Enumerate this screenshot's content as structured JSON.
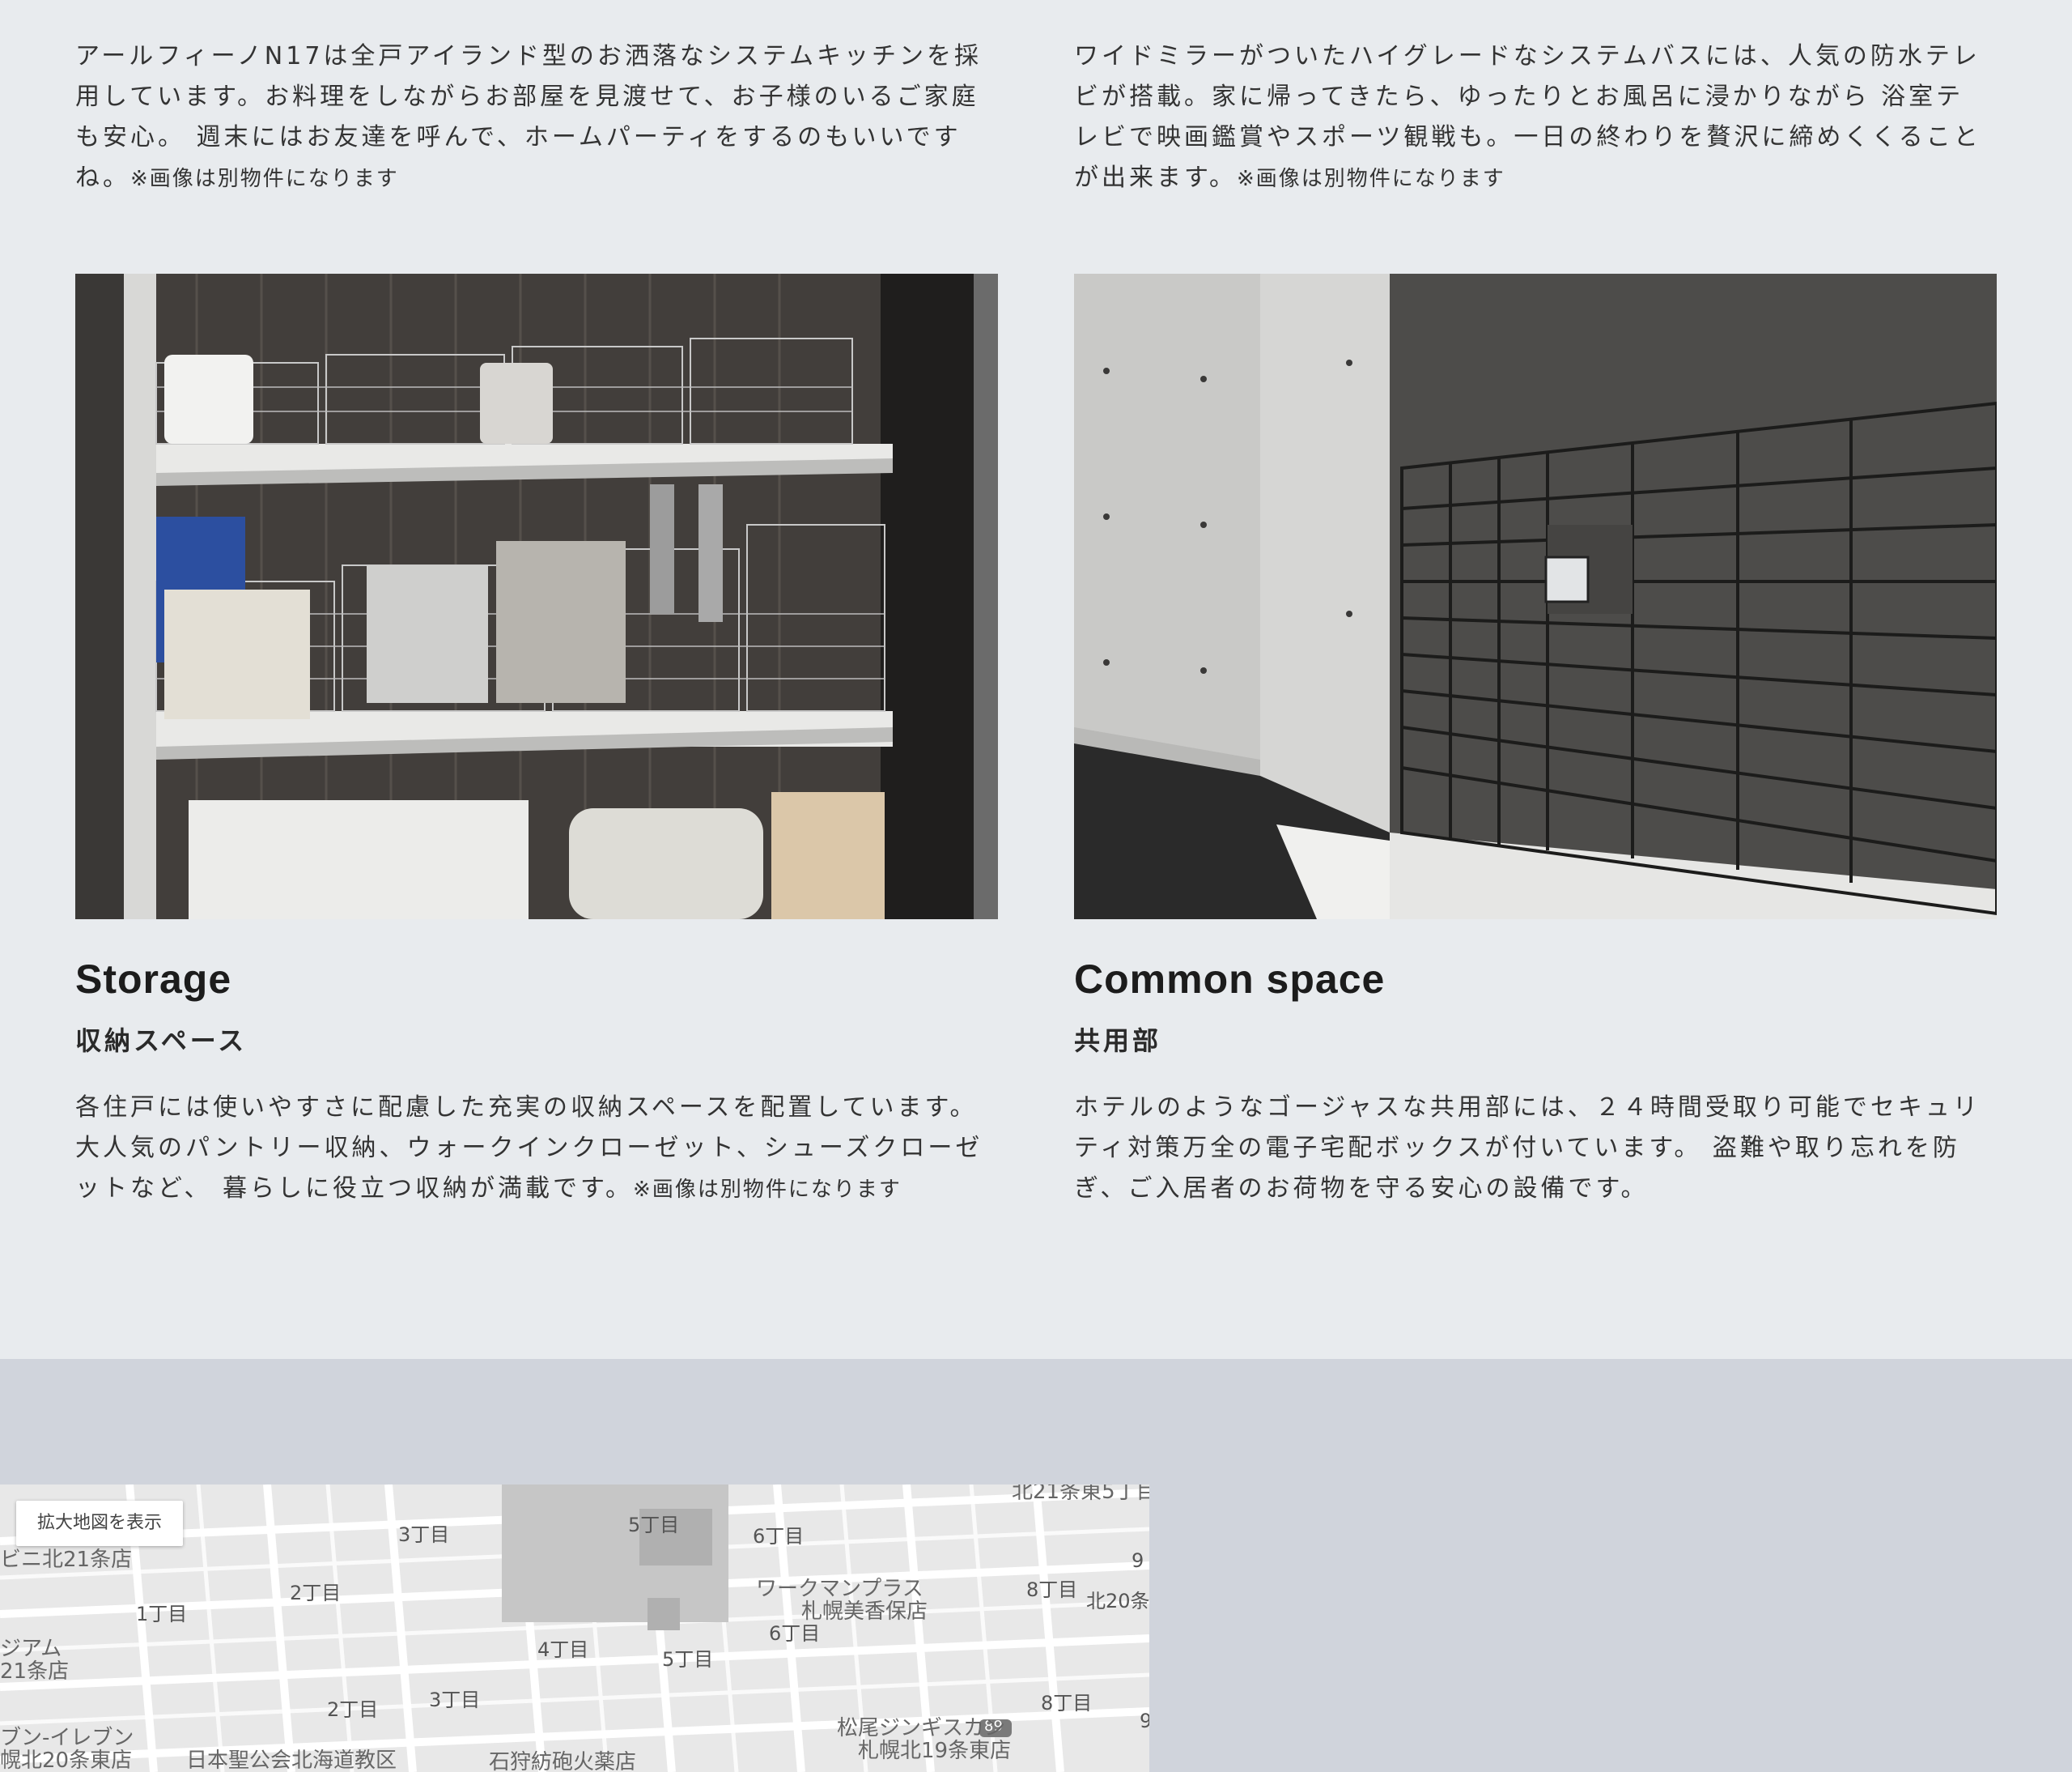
{
  "intro_left": {
    "text": "アールフィーノN17は全戸アイランド型のお洒落なシステムキッチンを採用しています。お料理をしながらお部屋を見渡せて、お子様のいるご家庭も安心。 週末にはお友達を呼んで、ホームパーティをするのもいいですね。",
    "note": "※画像は別物件になります"
  },
  "intro_right": {
    "text": "ワイドミラーがついたハイグレードなシステムバスには、人気の防水テレビが搭載。家に帰ってきたら、ゆったりとお風呂に浸かりながら 浴室テレビで映画鑑賞やスポーツ観戦も。一日の終わりを贅沢に締めくくることが出来ます。",
    "note": "※画像は別物件になります"
  },
  "features": [
    {
      "title": "Storage",
      "subtitle": "収納スペース",
      "text": "各住戸には使いやすさに配慮した充実の収納スペースを配置しています。大人気のパントリー収納、ウォークインクローゼット、シューズクローゼットなど、 暮らしに役立つ収納が満載です。",
      "note": "※画像は別物件になります"
    },
    {
      "title": "Common space",
      "subtitle": "共用部",
      "text": "ホテルのようなゴージャスな共用部には、２４時間受取り可能でセキュリティ対策万全の電子宅配ボックスが付いています。 盗難や取り忘れを防ぎ、ご入居者のお荷物を守る安心の設備です。"
    }
  ],
  "map": {
    "button_label": "拡大地図を表示",
    "labels": [
      "3丁目",
      "5丁目",
      "6丁目",
      "2丁目",
      "1丁目",
      "4丁目",
      "5丁目",
      "6丁目",
      "8丁目",
      "8丁目",
      "2丁目",
      "3丁目",
      "北20条",
      "9",
      "9",
      "89"
    ],
    "poi": [
      "ワークマンプラス",
      "札幌美香保店",
      "ビニ北21条店",
      "ジアム",
      "21条店",
      "ブン-イレブン",
      "幌北20条東店",
      "日本聖公会北海道教区",
      "石狩紡砲火薬店",
      "松尾ジンギスカン",
      "札幌北19条東店",
      "北21条東5丁目"
    ]
  }
}
